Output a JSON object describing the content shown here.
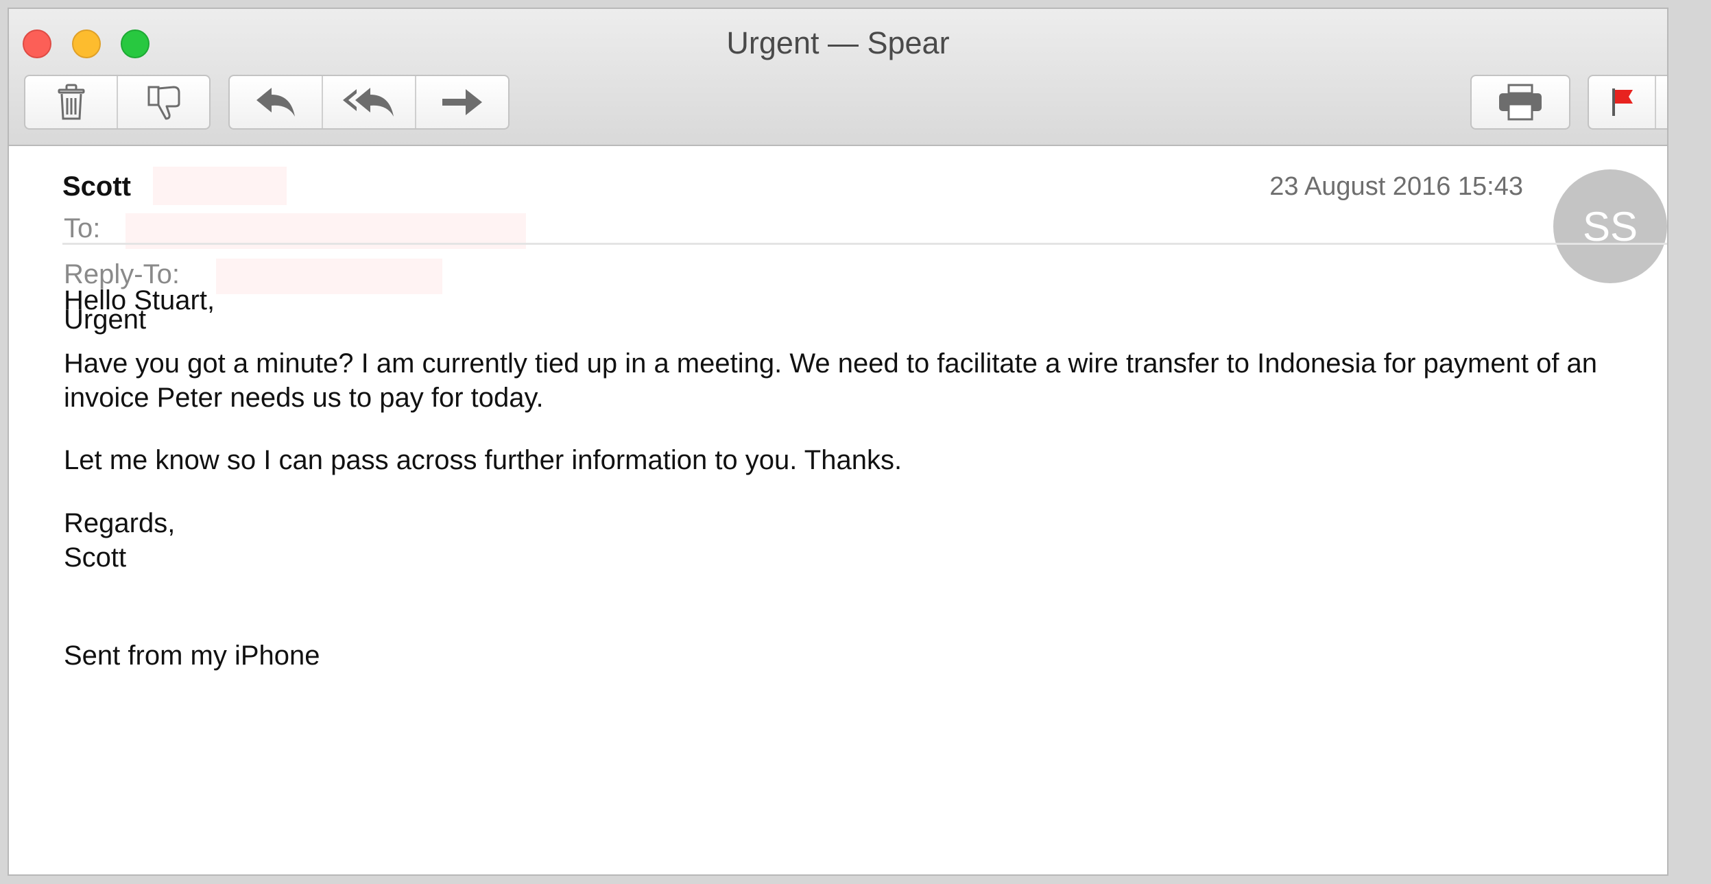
{
  "window": {
    "title": "Urgent — Spear"
  },
  "toolbar": {
    "icons": [
      "trash-icon",
      "junk-thumbs-down-icon",
      "reply-icon",
      "reply-all-icon",
      "forward-icon",
      "print-icon",
      "flag-icon",
      "chevron-down-icon"
    ],
    "flag_color": "#e8231f"
  },
  "message": {
    "sender": "Scott",
    "to_label": "To:",
    "reply_to_label": "Reply-To:",
    "subject": "Urgent",
    "date": "23 August 2016 15:43",
    "avatar_initials": "SS",
    "body": {
      "greeting": "Hello Stuart,",
      "paragraph1": "Have you got a minute? I am currently tied up in a meeting. We need to facilitate a wire transfer to Indonesia for payment of an invoice Peter needs us to pay for today.",
      "paragraph2": "Let me know so I can pass across further information to you. Thanks.",
      "closing": "Regards,",
      "signature": "Scott",
      "footer": "Sent from my iPhone"
    }
  }
}
